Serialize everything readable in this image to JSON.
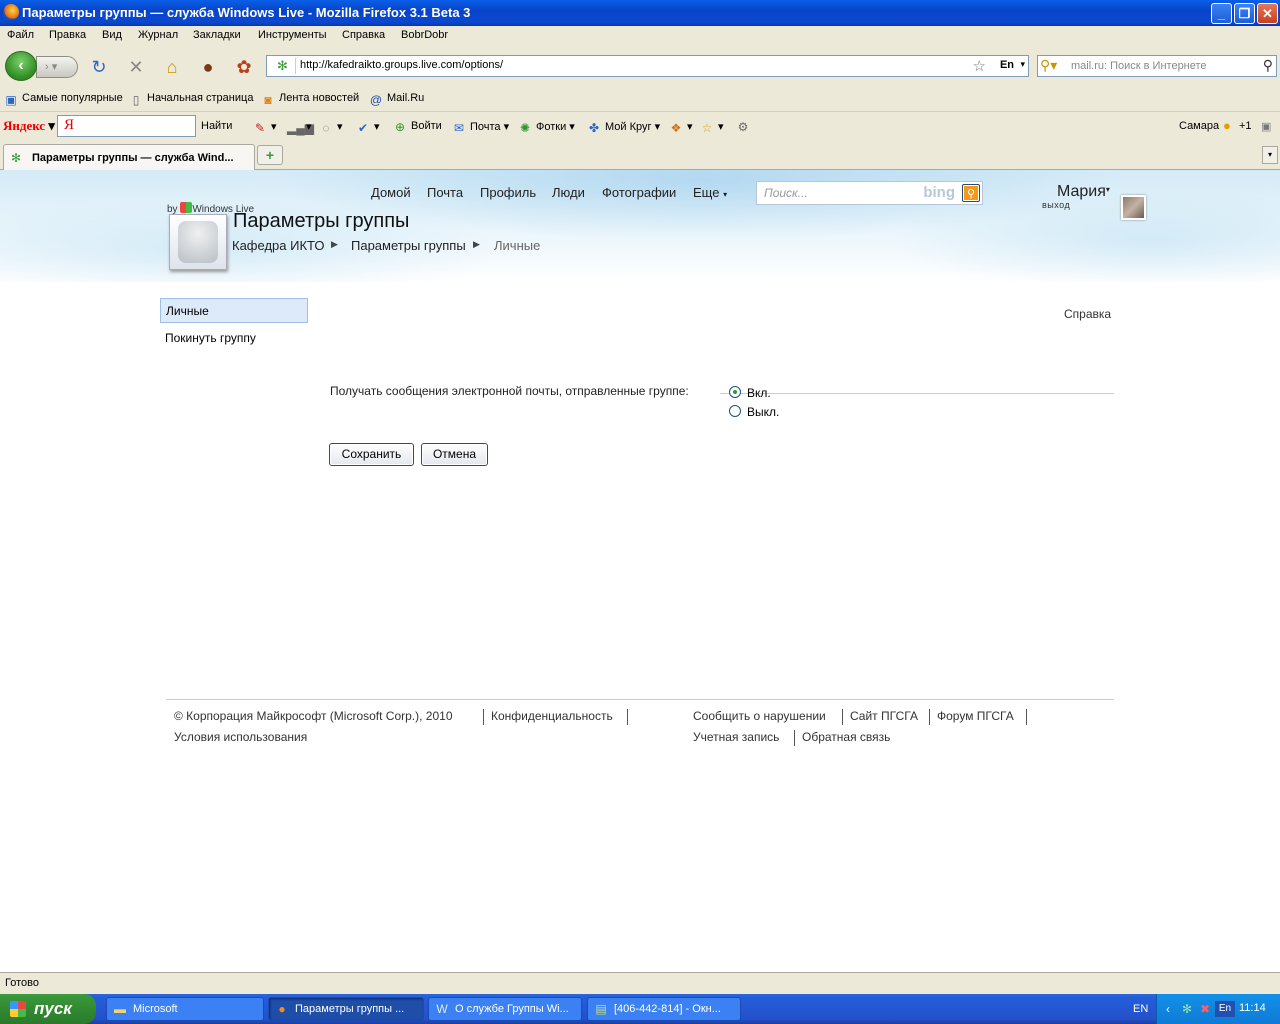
{
  "window": {
    "title": "Параметры группы — служба Windows Live - Mozilla Firefox 3.1 Beta 3",
    "minimize": "_",
    "maximize": "❐",
    "close": "✕"
  },
  "menu": {
    "items": [
      "Файл",
      "Правка",
      "Вид",
      "Журнал",
      "Закладки",
      "Инструменты",
      "Справка",
      "BobrDobr"
    ]
  },
  "navbar": {
    "url": "http://kafedraikto.groups.live.com/options/",
    "lang": "En",
    "search_placeholder": "mail.ru: Поиск в Интернете"
  },
  "bookmarks": {
    "items": [
      "Самые популярные",
      "Начальная страница",
      "Лента новостей",
      "Mail.Ru"
    ]
  },
  "yandex": {
    "logo": "Яндекс",
    "find": "Найти",
    "login": "Войти",
    "mail": "Почта",
    "photos": "Фотки",
    "circle": "Мой Круг",
    "city": "Самара",
    "temp": "+1"
  },
  "tabs": {
    "active_label": "Параметры группы — служба Wind...",
    "new_tab": "+"
  },
  "site": {
    "nav": [
      "Домой",
      "Почта",
      "Профиль",
      "Люди",
      "Фотографии",
      "Еще"
    ],
    "search_placeholder": "Поиск...",
    "search_brand": "bing",
    "user_name": "Мария",
    "logout": "выход",
    "brand_by": "by",
    "brand": "Windows Live",
    "page_title": "Параметры группы",
    "breadcrumb": [
      "Кафедра ИКТО",
      "Параметры группы",
      "Личные"
    ]
  },
  "sidebar": {
    "active": "Личные",
    "items": [
      "Покинуть группу"
    ]
  },
  "help": "Справка",
  "settings": {
    "email_label": "Получать сообщения электронной почты, отправленные группе:",
    "on": "Вкл.",
    "off": "Выкл.",
    "selected": "on",
    "save": "Сохранить",
    "cancel": "Отмена"
  },
  "footer": {
    "copyright": "© Корпорация Майкрософт (Microsoft Corp.), 2010",
    "privacy": "Конфиденциальность",
    "terms": "Условия использования",
    "report": "Сообщить о нарушении",
    "site": "Сайт ПГСГА",
    "forum": "Форум ПГСГА",
    "account": "Учетная запись",
    "feedback": "Обратная связь"
  },
  "status": "Готово",
  "taskbar": {
    "start": "пуск",
    "tasks": [
      "Microsoft",
      "Параметры группы ...",
      "О службе Группы Wi...",
      "[406-442-814] - Окн..."
    ],
    "lang": "EN",
    "time": "11:14"
  }
}
